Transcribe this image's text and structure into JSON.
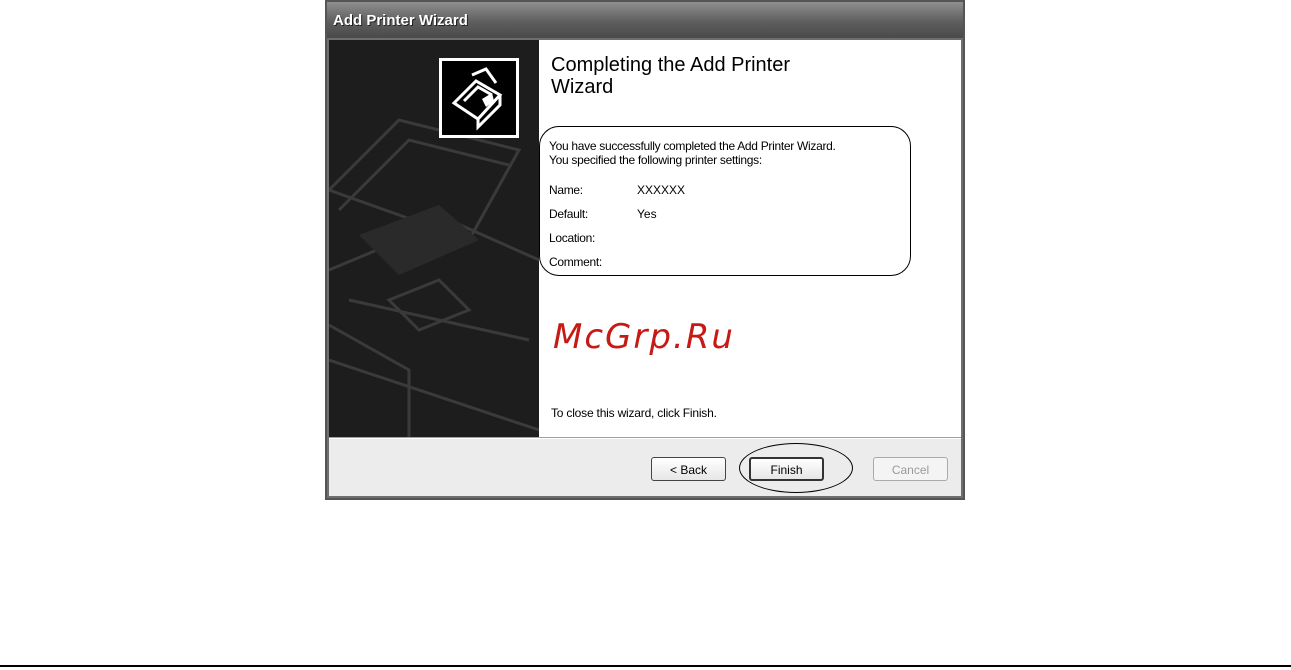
{
  "window": {
    "title": "Add Printer Wizard"
  },
  "icons": {
    "sidebar": "printer-graphic",
    "wizard": "printer-icon"
  },
  "content": {
    "heading_line1": "Completing the Add Printer",
    "heading_line2": "Wizard",
    "intro_line1": "You have successfully completed the Add Printer Wizard.",
    "intro_line2": "You specified the following printer settings:",
    "settings": [
      {
        "label": "Name:",
        "value": "XXXXXX"
      },
      {
        "label": "Default:",
        "value": "Yes"
      },
      {
        "label": "Location:",
        "value": ""
      },
      {
        "label": "Comment:",
        "value": ""
      }
    ],
    "watermark": "McGrp.Ru",
    "closing": "To close this wizard, click Finish."
  },
  "buttons": {
    "back": "< Back",
    "finish": "Finish",
    "cancel": "Cancel"
  },
  "colors": {
    "watermark": "#c61a15",
    "sidebar": "#1d1d1d"
  }
}
